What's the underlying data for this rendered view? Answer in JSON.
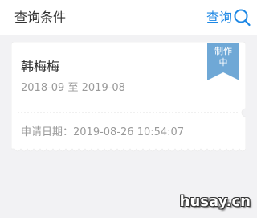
{
  "header": {
    "title": "查询条件",
    "query_label": "查询"
  },
  "card": {
    "name": "韩梅梅",
    "start": "2018-09",
    "separator": "至",
    "end": "2019-08",
    "status_line1": "制作",
    "status_line2": "中",
    "apply_label": "申请日期：",
    "apply_value": "2019-08-26 10:54:07"
  },
  "watermark": "husay.cn",
  "colors": {
    "accent": "#1e88e5",
    "ribbon": "#6fa8d6",
    "background": "#f2f2f4",
    "card": "#ffffff",
    "muted_text": "#9a9a9a"
  },
  "icons": {
    "query": "search-icon"
  }
}
